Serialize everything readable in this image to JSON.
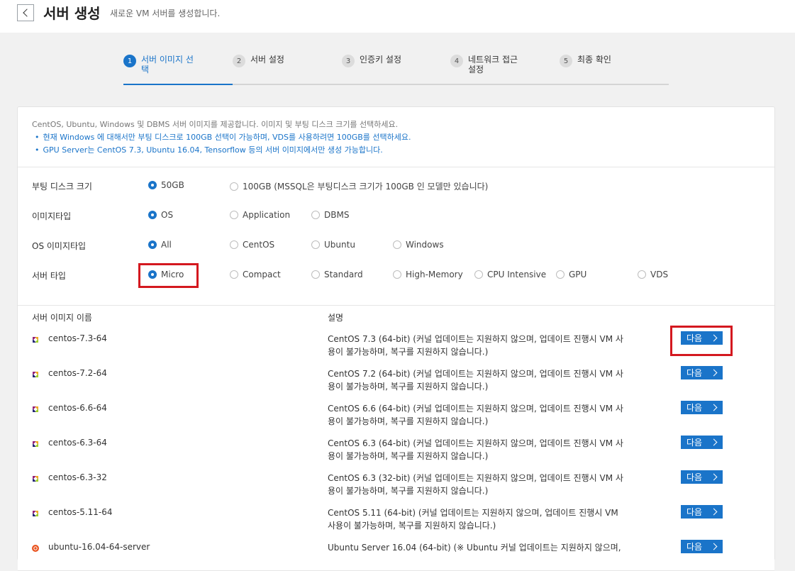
{
  "header": {
    "title": "서버 생성",
    "subtitle": "새로운 VM 서버를 생성합니다.",
    "back_icon": "chevron-left-icon"
  },
  "steps": [
    {
      "num": "1",
      "label": "서버 이미지 선\n택",
      "active": true
    },
    {
      "num": "2",
      "label": "서버 설정",
      "active": false
    },
    {
      "num": "3",
      "label": "인증키 설정",
      "active": false
    },
    {
      "num": "4",
      "label": "네트워크 접근\n설정",
      "active": false
    },
    {
      "num": "5",
      "label": "최종 확인",
      "active": false
    }
  ],
  "info": {
    "intro": "CentOS, Ubuntu, Windows 및 DBMS 서버 이미지를 제공합니다. 이미지 및 부팅 디스크 크기를 선택하세요.",
    "notes": [
      "현재 Windows 에 대해서만 부팅 디스크로 100GB 선택이 가능하며, VDS를 사용하려면 100GB를 선택하세요.",
      "GPU Server는 CentOS 7.3, Ubuntu 16.04, Tensorflow 등의 서버 이미지에서만 생성 가능합니다."
    ]
  },
  "options": {
    "boot_disk": {
      "label": "부팅 디스크 크기",
      "choices": [
        "50GB",
        "100GB (MSSQL은 부팅디스크 크기가 100GB 인 모델만 있습니다)"
      ],
      "selected": 0
    },
    "image_type": {
      "label": "이미지타입",
      "choices": [
        "OS",
        "Application",
        "DBMS"
      ],
      "selected": 0
    },
    "os_image_type": {
      "label": "OS 이미지타입",
      "choices": [
        "All",
        "CentOS",
        "Ubuntu",
        "Windows"
      ],
      "selected": 0
    },
    "server_type": {
      "label": "서버 타입",
      "choices": [
        "Micro",
        "Compact",
        "Standard",
        "High-Memory",
        "CPU Intensive",
        "GPU",
        "VDS"
      ],
      "selected": 0
    }
  },
  "table": {
    "col_name": "서버 이미지 이름",
    "col_desc": "설명",
    "next_label": "다음",
    "rows": [
      {
        "icon": "centos-icon",
        "name": "centos-7.3-64",
        "desc": "CentOS 7.3 (64-bit) (커널 업데이트는 지원하지 않으며, 업데이트 진행시 VM 사용이 불가능하며, 복구를 지원하지 않습니다.)"
      },
      {
        "icon": "centos-icon",
        "name": "centos-7.2-64",
        "desc": "CentOS 7.2 (64-bit) (커널 업데이트는 지원하지 않으며, 업데이트 진행시 VM 사용이 불가능하며, 복구를 지원하지 않습니다.)"
      },
      {
        "icon": "centos-icon",
        "name": "centos-6.6-64",
        "desc": "CentOS 6.6 (64-bit) (커널 업데이트는 지원하지 않으며, 업데이트 진행시 VM 사용이 불가능하며, 복구를 지원하지 않습니다.)"
      },
      {
        "icon": "centos-icon",
        "name": "centos-6.3-64",
        "desc": "CentOS 6.3 (64-bit) (커널 업데이트는 지원하지 않으며, 업데이트 진행시 VM 사용이 불가능하며, 복구를 지원하지 않습니다.)"
      },
      {
        "icon": "centos-icon",
        "name": "centos-6.3-32",
        "desc": "CentOS 6.3 (32-bit) (커널 업데이트는 지원하지 않으며, 업데이트 진행시 VM 사용이 불가능하며, 복구를 지원하지 않습니다.)"
      },
      {
        "icon": "centos-icon",
        "name": "centos-5.11-64",
        "desc": "CentOS 5.11 (64-bit) (커널 업데이트는 지원하지 않으며, 업데이트 진행시 VM 사용이 불가능하며, 복구를 지원하지 않습니다.)"
      },
      {
        "icon": "ubuntu-icon",
        "name": "ubuntu-16.04-64-server",
        "desc": "Ubuntu Server 16.04 (64-bit) (※ Ubuntu 커널 업데이트는 지원하지 않으며,"
      }
    ]
  },
  "colors": {
    "accent": "#1a74c9",
    "highlight": "#d4181f"
  }
}
